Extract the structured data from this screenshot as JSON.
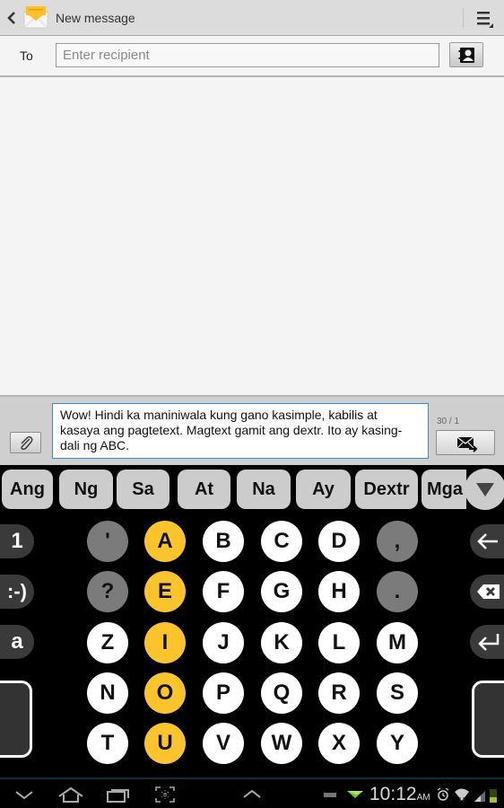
{
  "actionbar": {
    "title": "New message",
    "icons": [
      "back-chevron-icon",
      "messaging-envelope-icon",
      "overflow-menu-icon"
    ]
  },
  "recipient": {
    "label": "To",
    "value": "",
    "placeholder": "Enter recipient",
    "contact_icon": "contacts-picker-icon"
  },
  "compose": {
    "message": "Wow! Hindi ka maniniwala kung gano kasimple, kabilis at kasaya ang pagtetext. Magtext gamit ang dextr. Ito ay kasing-dali ng ABC.",
    "counter": "30 / 1",
    "attach_icon": "paperclip-icon",
    "send_icon": "send-message-icon"
  },
  "keyboard": {
    "suggestions": [
      "Ang",
      "Ng",
      "Sa",
      "At",
      "Na",
      "Ay",
      "Dextr",
      "Mga"
    ],
    "suggestions_more_icon": "triangle-down-icon",
    "rows": [
      [
        {
          "k": "'",
          "t": "punct"
        },
        {
          "k": "A",
          "t": "vowel"
        },
        {
          "k": "B",
          "t": "cons"
        },
        {
          "k": "C",
          "t": "cons"
        },
        {
          "k": "D",
          "t": "cons"
        },
        {
          "k": ",",
          "t": "punct"
        }
      ],
      [
        {
          "k": "?",
          "t": "punct"
        },
        {
          "k": "E",
          "t": "vowel"
        },
        {
          "k": "F",
          "t": "cons"
        },
        {
          "k": "G",
          "t": "cons"
        },
        {
          "k": "H",
          "t": "cons"
        },
        {
          "k": ".",
          "t": "punct"
        }
      ],
      [
        {
          "k": "Z",
          "t": "cons"
        },
        {
          "k": "I",
          "t": "vowel"
        },
        {
          "k": "J",
          "t": "cons"
        },
        {
          "k": "K",
          "t": "cons"
        },
        {
          "k": "L",
          "t": "cons"
        },
        {
          "k": "M",
          "t": "cons"
        }
      ],
      [
        {
          "k": "N",
          "t": "cons"
        },
        {
          "k": "O",
          "t": "vowel"
        },
        {
          "k": "P",
          "t": "cons"
        },
        {
          "k": "Q",
          "t": "cons"
        },
        {
          "k": "R",
          "t": "cons"
        },
        {
          "k": "S",
          "t": "cons"
        }
      ],
      [
        {
          "k": "T",
          "t": "cons"
        },
        {
          "k": "U",
          "t": "vowel"
        },
        {
          "k": "V",
          "t": "cons"
        },
        {
          "k": "W",
          "t": "cons"
        },
        {
          "k": "X",
          "t": "cons"
        },
        {
          "k": "Y",
          "t": "cons"
        }
      ]
    ],
    "left_keys": [
      "1",
      ":-)",
      "a"
    ],
    "right_keys": [
      "left-arrow-icon",
      "backspace-icon",
      "enter-icon"
    ],
    "colors": {
      "vowel": "#fbc42c",
      "consonant": "#ffffff",
      "punct": "#7b7b7b",
      "suggestion": "#cccccc"
    }
  },
  "statusbar": {
    "time": "10:12",
    "ampm": "AM",
    "icons": [
      "nav-back-icon",
      "home-icon",
      "recent-apps-icon",
      "screenshot-icon",
      "up-chevron-icon",
      "keyboard-icon",
      "notification-icon",
      "alarm-icon",
      "wifi-icon",
      "signal-icon",
      "battery-icon"
    ]
  }
}
